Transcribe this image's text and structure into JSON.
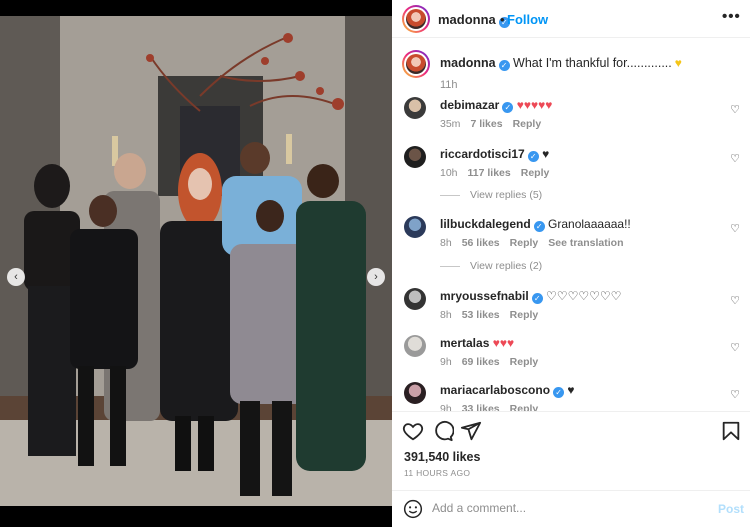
{
  "post": {
    "username": "madonna",
    "separator": "•",
    "follow_label": "Follow",
    "more_icon": "more-horizontal-icon",
    "caption_text": "What I'm thankful for.............",
    "caption_time": "11h",
    "likes_label": "391,540 likes",
    "time_ago": "11 HOURS AGO"
  },
  "comments": [
    {
      "username": "debimazar",
      "text": "",
      "hearts": "♥♥♥♥♥",
      "heart_color": "#ed4956",
      "time": "35m",
      "likes": "7 likes",
      "reply": "Reply",
      "translate": ""
    },
    {
      "username": "riccardotisci17",
      "text": "",
      "hearts": "♥",
      "heart_color": "#262626",
      "time": "10h",
      "likes": "117 likes",
      "reply": "Reply",
      "translate": "",
      "view_replies": "View replies (5)"
    },
    {
      "username": "lilbuckdalegend",
      "text": "Granolaaaaaa!!",
      "hearts": "",
      "heart_color": "#262626",
      "time": "8h",
      "likes": "56 likes",
      "reply": "Reply",
      "translate": "See translation",
      "view_replies": "View replies (2)"
    },
    {
      "username": "mryoussefnabil",
      "text": "",
      "hearts": "♡♡♡♡♡♡♡",
      "heart_color": "#262626",
      "time": "8h",
      "likes": "53 likes",
      "reply": "Reply",
      "translate": ""
    },
    {
      "username": "mertalas",
      "text": "",
      "hearts": "♥♥♥",
      "heart_color": "#ed4956",
      "time": "9h",
      "likes": "69 likes",
      "reply": "Reply",
      "translate": ""
    },
    {
      "username": "mariacarlabosсono",
      "text": "",
      "hearts": "♥",
      "heart_color": "#262626",
      "time": "9h",
      "likes": "33 likes",
      "reply": "Reply",
      "translate": ""
    }
  ],
  "add_comment": {
    "placeholder": "Add a comment...",
    "post_label": "Post"
  },
  "icons": {
    "verified": "✓",
    "heart_outline": "♡",
    "prev": "‹",
    "next": "›"
  },
  "colors": {
    "accent": "#0095f6",
    "verified": "#3897f0",
    "like_red": "#ed4956",
    "muted": "#8e8e8e"
  }
}
